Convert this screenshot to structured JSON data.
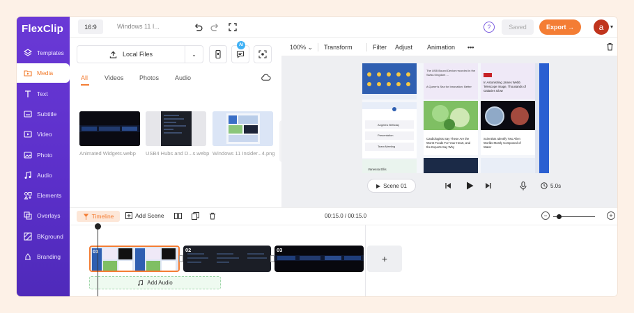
{
  "app": {
    "logo": "FlexClip",
    "brand_colors": {
      "sidebar": "#5b2fc9",
      "accent": "#f47d34"
    }
  },
  "sidebar": {
    "items": [
      {
        "label": "Templates",
        "icon": "layers-icon"
      },
      {
        "label": "Media",
        "icon": "media-folder-icon",
        "active": true
      },
      {
        "label": "Text",
        "icon": "text-icon"
      },
      {
        "label": "Subtitle",
        "icon": "subtitle-icon"
      },
      {
        "label": "Video",
        "icon": "video-icon"
      },
      {
        "label": "Photo",
        "icon": "photo-icon"
      },
      {
        "label": "Audio",
        "icon": "music-icon"
      },
      {
        "label": "Elements",
        "icon": "elements-icon"
      },
      {
        "label": "Overlays",
        "icon": "overlays-icon"
      },
      {
        "label": "BKground",
        "icon": "background-icon"
      },
      {
        "label": "Branding",
        "icon": "branding-icon"
      }
    ]
  },
  "topbar": {
    "ratio": "16:9",
    "doc_title": "Windows 11 I...",
    "saved_label": "Saved",
    "export_label": "Export →",
    "avatar_letter": "a"
  },
  "media_panel": {
    "local_files_label": "Local Files",
    "ai_badge": "AI",
    "tabs": [
      "All",
      "Videos",
      "Photos",
      "Audio"
    ],
    "active_tab": "All",
    "items": [
      {
        "name": "Animated Widgets.webp"
      },
      {
        "name": "USB4 Hubs and D...s.webp"
      },
      {
        "name": "Windows 11 Insider...4.png"
      }
    ]
  },
  "editor": {
    "zoom": "100%",
    "tools": [
      "Transform",
      "Filter",
      "Adjust",
      "Animation"
    ],
    "more": "•••",
    "scene_label": "Scene  01",
    "duration": "5.0s",
    "canvas_text": {
      "news1": "The USB Bound Device recorded in the Swiss Kingdom ...",
      "news1_by": "A Queen's Sea for Innovation: Better",
      "news2_src": "ESPN",
      "news2": "In Astonishing James Webb Telescope Image, Thousands of Galaxies Glow",
      "news3": "Cardiologists Say These Are the Worst Foods For Your Heart, and the Experts Say Why",
      "news4": "Scientists Identify Two Alien Worlds Mostly Composed of Water",
      "widget_name": "Vanessa Ellis",
      "cal1": "Angela's Birthday",
      "cal2": "Presentation",
      "cal3": "Team Meeting"
    }
  },
  "timeline": {
    "label": "Timeline",
    "add_scene": "Add Scene",
    "time": "00:15.0 / 00:15.0",
    "clips": [
      "01",
      "02",
      "03"
    ],
    "add_clip": "+",
    "add_audio": "Add Audio"
  }
}
